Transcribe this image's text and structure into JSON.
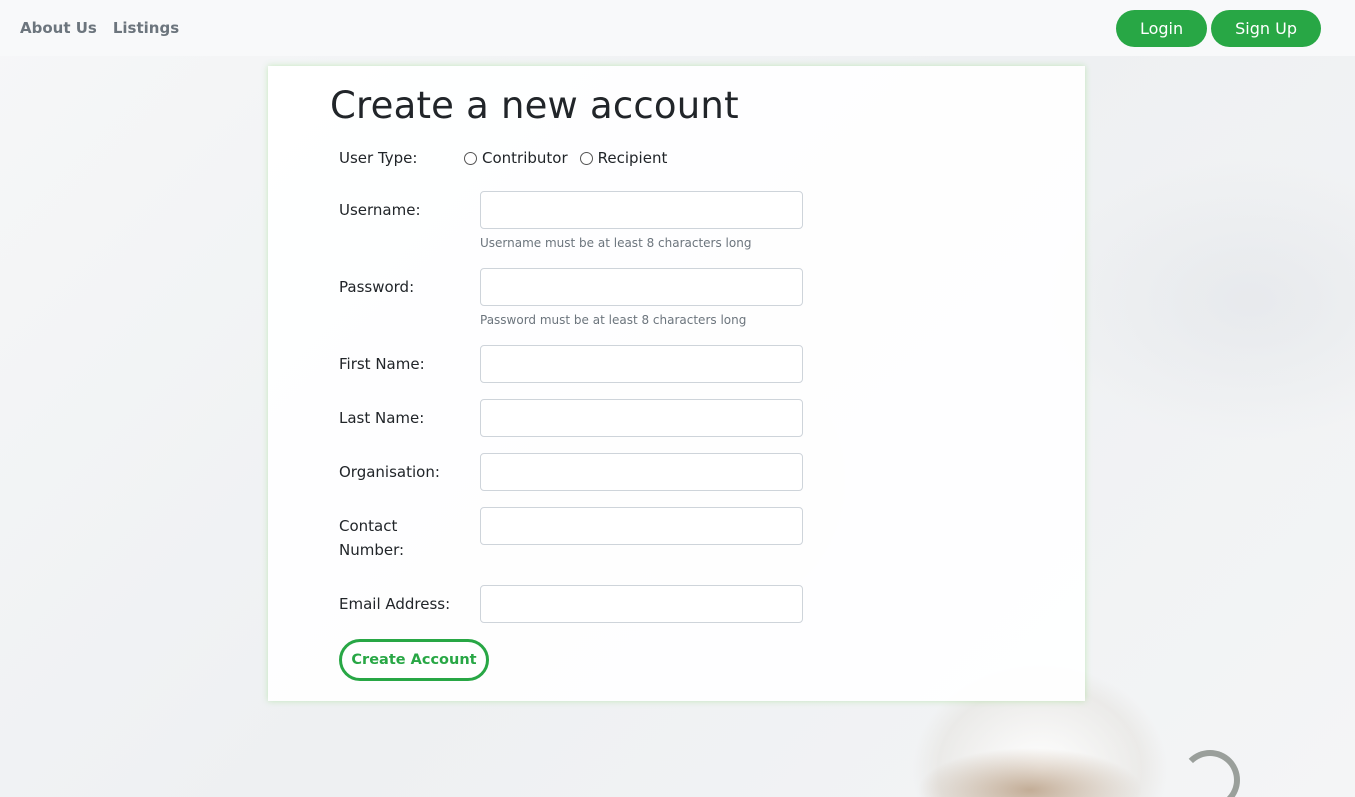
{
  "nav": {
    "links": [
      "About Us",
      "Listings"
    ],
    "login_label": "Login",
    "signup_label": "Sign Up"
  },
  "form": {
    "title": "Create a new account",
    "user_type_label": "User Type:",
    "user_type_options": [
      "Contributor",
      "Recipient"
    ],
    "username_label": "Username:",
    "username_value": "",
    "username_help": "Username must be at least 8 characters long",
    "password_label": "Password:",
    "password_value": "",
    "password_help": "Password must be at least 8 characters long",
    "first_name_label": "First Name:",
    "last_name_label": "Last Name:",
    "organisation_label": "Organisation:",
    "contact_label_line1": "Contact",
    "contact_label_line2": "Number:",
    "email_label": "Email Address:",
    "submit_label": "Create Account"
  },
  "colors": {
    "accent": "#28a745",
    "nav_text": "#6c757d",
    "help_text": "#6c757d"
  }
}
